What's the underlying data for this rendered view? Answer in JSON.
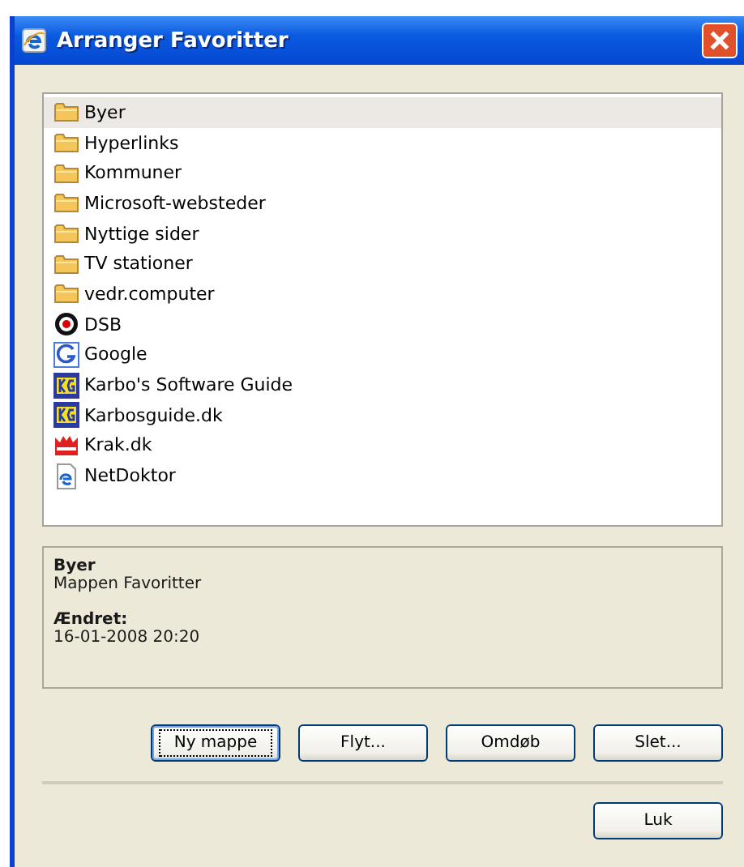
{
  "window": {
    "title": "Arranger Favoritter"
  },
  "favorites": [
    {
      "label": "Byer",
      "kind": "folder",
      "selected": true
    },
    {
      "label": "Hyperlinks",
      "kind": "folder",
      "selected": false
    },
    {
      "label": "Kommuner",
      "kind": "folder",
      "selected": false
    },
    {
      "label": "Microsoft-websteder",
      "kind": "folder",
      "selected": false
    },
    {
      "label": "Nyttige sider",
      "kind": "folder",
      "selected": false
    },
    {
      "label": "TV stationer",
      "kind": "folder",
      "selected": false
    },
    {
      "label": "vedr.computer",
      "kind": "folder",
      "selected": false
    },
    {
      "label": "DSB",
      "kind": "target",
      "selected": false
    },
    {
      "label": "Google",
      "kind": "g",
      "selected": false
    },
    {
      "label": "Karbo's Software Guide",
      "kind": "kg",
      "selected": false
    },
    {
      "label": "Karbosguide.dk",
      "kind": "kg",
      "selected": false
    },
    {
      "label": "Krak.dk",
      "kind": "crown",
      "selected": false
    },
    {
      "label": "NetDoktor",
      "kind": "page",
      "selected": false
    }
  ],
  "details": {
    "name": "Byer",
    "description": "Mappen Favoritter",
    "modified_label": "Ændret:",
    "modified": "16-01-2008 20:20"
  },
  "buttons": [
    {
      "label": "Ny mappe",
      "focused": true
    },
    {
      "label": "Flyt...",
      "focused": false
    },
    {
      "label": "Omdøb",
      "focused": false
    },
    {
      "label": "Slet...",
      "focused": false
    }
  ],
  "close_button": "Luk"
}
